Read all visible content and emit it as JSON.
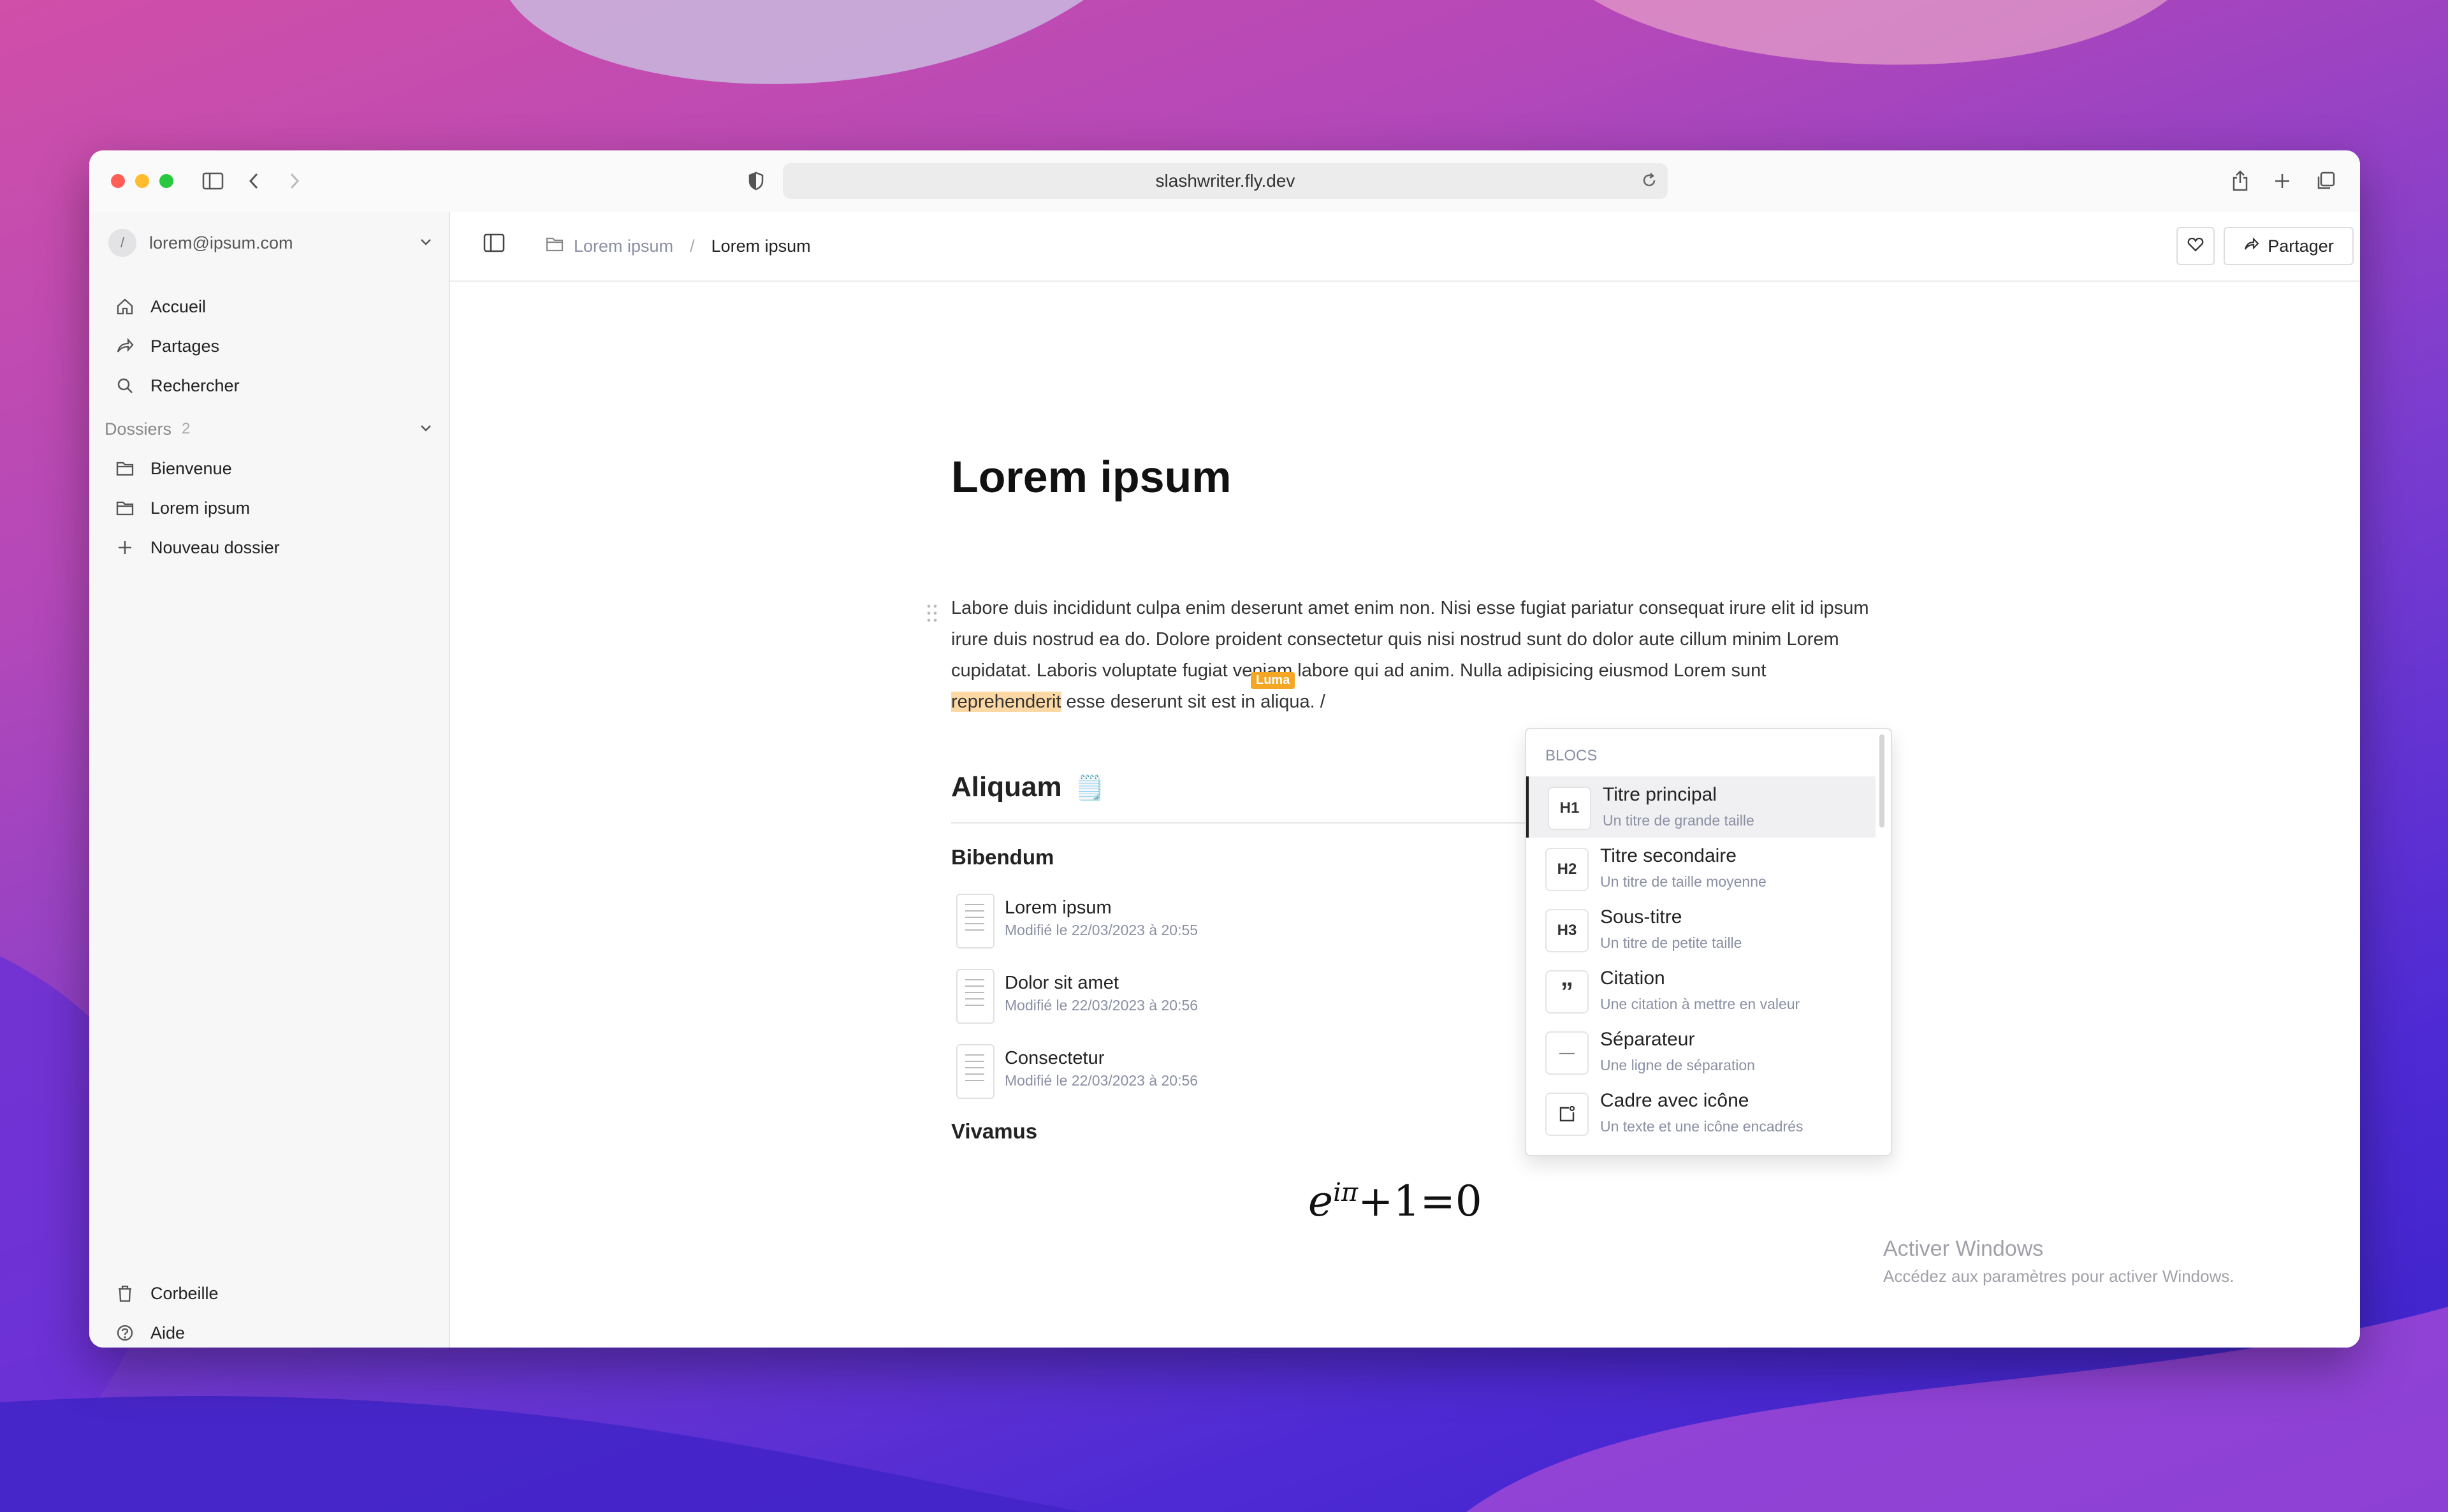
{
  "browser": {
    "url": "slashwriter.fly.dev"
  },
  "sidebar": {
    "account": "lorem@ipsum.com",
    "avatar_letter": "/",
    "nav": [
      {
        "label": "Accueil",
        "icon": "home-icon"
      },
      {
        "label": "Partages",
        "icon": "share-icon"
      },
      {
        "label": "Rechercher",
        "icon": "search-icon"
      }
    ],
    "folders_label": "Dossiers",
    "folders_count": "2",
    "folders": [
      {
        "label": "Bienvenue",
        "icon": "folder-icon"
      },
      {
        "label": "Lorem ipsum",
        "icon": "folder-icon"
      }
    ],
    "new_folder": "Nouveau dossier",
    "trash": "Corbeille",
    "help": "Aide"
  },
  "topbar": {
    "breadcrumb_folder": "Lorem ipsum",
    "breadcrumb_separator": "/",
    "breadcrumb_current": "Lorem ipsum",
    "share_label": "Partager"
  },
  "document": {
    "title": "Lorem ipsum",
    "para_before": "Labore duis incididunt culpa enim deserunt amet enim non. Nisi esse fugiat pariatur consequat irure elit id ipsum irure duis nostrud ea do. Dolore proident consectetur quis nisi nostrud sunt do dolor aute cillum minim Lorem cupidatat. Laboris voluptate fugiat veniam labore qui ad anim. Nulla adipisicing eiusmod Lorem sunt ",
    "para_highlight": "reprehenderit",
    "para_after": " esse deserunt sit est in aliqua. /",
    "collab_badge": "Luma",
    "heading2": "Aliquam",
    "heading2_emoji": "🗒️",
    "heading3a": "Bibendum",
    "pages": [
      {
        "title": "Lorem ipsum",
        "modified": "Modifié le 22/03/2023 à 20:55"
      },
      {
        "title": "Dolor sit amet",
        "modified": "Modifié le 22/03/2023 à 20:56"
      },
      {
        "title": "Consectetur",
        "modified": "Modifié le 22/03/2023 à 20:56"
      }
    ],
    "heading3b": "Vivamus",
    "formula_base": "e",
    "formula_exp": "iπ",
    "formula_rest": "+1=0"
  },
  "slash_menu": {
    "section": "BLOCS",
    "items": [
      {
        "icon_text": "H1",
        "title": "Titre principal",
        "subtitle": "Un titre de grande taille"
      },
      {
        "icon_text": "H2",
        "title": "Titre secondaire",
        "subtitle": "Un titre de taille moyenne"
      },
      {
        "icon_text": "H3",
        "title": "Sous-titre",
        "subtitle": "Un titre de petite taille"
      },
      {
        "icon_text": "”",
        "title": "Citation",
        "subtitle": "Une citation à mettre en valeur"
      },
      {
        "icon_text": "—",
        "title": "Séparateur",
        "subtitle": "Une ligne de séparation"
      },
      {
        "icon_text": "",
        "title": "Cadre avec icône",
        "subtitle": "Un texte et une icône encadrés"
      }
    ]
  },
  "watermark": {
    "title": "Activer Windows",
    "subtitle": "Accédez aux paramètres pour activer Windows."
  }
}
